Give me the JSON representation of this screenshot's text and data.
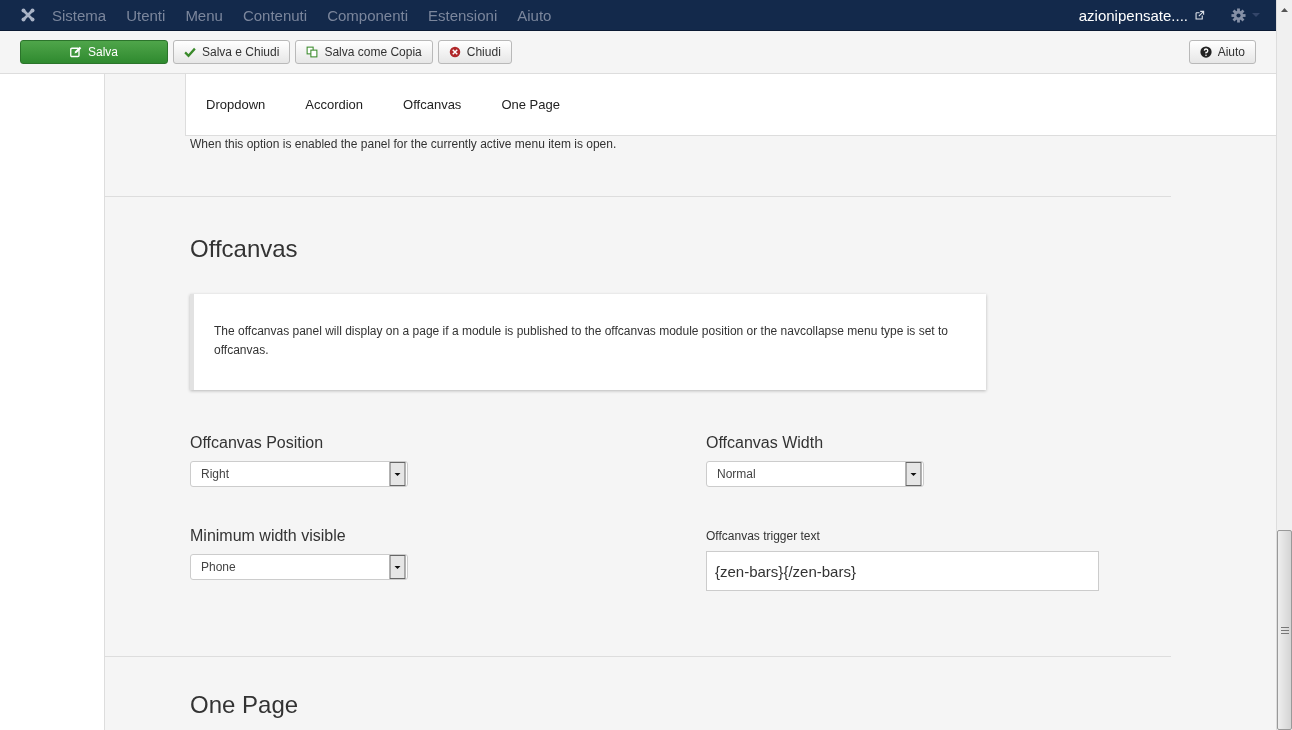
{
  "navbar": {
    "menu": [
      "Sistema",
      "Utenti",
      "Menu",
      "Contenuti",
      "Componenti",
      "Estensioni",
      "Aiuto"
    ],
    "site_link": "azionipensate...."
  },
  "toolbar": {
    "buttons": [
      {
        "label": "Salva",
        "kind": "primary"
      },
      {
        "label": "Salva e Chiudi",
        "kind": "default"
      },
      {
        "label": "Salva come Copia",
        "kind": "default"
      },
      {
        "label": "Chiudi",
        "kind": "default"
      }
    ],
    "help": "Aiuto"
  },
  "tabs": [
    "Dropdown",
    "Accordion",
    "Offcanvas",
    "One Page"
  ],
  "previous_section": {
    "description": "When this option is enabled the panel for the currently active menu item is open."
  },
  "offcanvas": {
    "title": "Offcanvas",
    "note": "The offcanvas panel will display on a page if a module is published to the offcanvas module position or the navcollapse menu type is set to offcanvas.",
    "fields": [
      {
        "label": "Offcanvas Position",
        "kind": "select",
        "value": "Right"
      },
      {
        "label": "Offcanvas Width",
        "kind": "select",
        "value": "Normal"
      },
      {
        "label": "Minimum width visible",
        "kind": "select",
        "value": "Phone"
      },
      {
        "label": "Offcanvas trigger text",
        "kind": "text",
        "value": "{zen-bars}{/zen-bars}"
      }
    ]
  },
  "next_section": {
    "title": "One Page"
  }
}
